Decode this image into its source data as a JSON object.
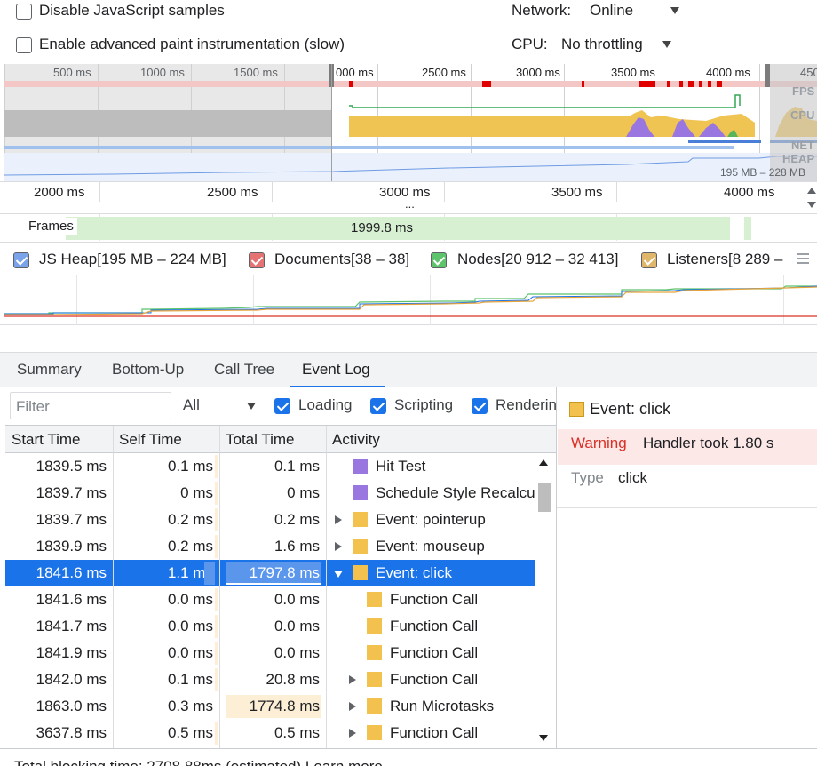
{
  "settings": {
    "disable_js_samples": "Disable JavaScript samples",
    "advanced_paint": "Enable advanced paint instrumentation (slow)",
    "network_label": "Network:",
    "network_value": "Online",
    "cpu_label": "CPU:",
    "cpu_value": "No throttling"
  },
  "overview": {
    "ticks": [
      "500 ms",
      "1000 ms",
      "1500 ms",
      "000 ms",
      "2500 ms",
      "3000 ms",
      "3500 ms",
      "4000 ms",
      "450"
    ],
    "tracks": [
      "FPS",
      "CPU",
      "NET",
      "HEAP"
    ],
    "heap_range": "195 MB – 228 MB"
  },
  "ruler": {
    "ticks": [
      "2000 ms",
      "2500 ms",
      "3000 ms",
      "3500 ms",
      "4000 ms"
    ],
    "ellipsis": "..."
  },
  "frames": {
    "label": "Frames",
    "value": "1999.8 ms"
  },
  "memory_legend": [
    {
      "label": "JS Heap[195 MB – 224 MB]",
      "color": "#8ab4f8"
    },
    {
      "label": "Documents[38 – 38]",
      "color": "#e57373"
    },
    {
      "label": "Nodes[20 912 – 32 413]",
      "color": "#81c995"
    },
    {
      "label": "Listeners[8 289 –",
      "color": "#e0b76a"
    }
  ],
  "tabs": [
    "Summary",
    "Bottom-Up",
    "Call Tree",
    "Event Log"
  ],
  "filter": {
    "placeholder": "Filter",
    "select_value": "All",
    "checks": [
      "Loading",
      "Scripting",
      "Renderin"
    ]
  },
  "columns": [
    "Start Time",
    "Self Time",
    "Total Time",
    "Activity"
  ],
  "rows": [
    {
      "start": "1839.5 ms",
      "self": "0.1 ms",
      "total": "0.1 ms",
      "activity": "Hit Test",
      "color": "#9a77e0",
      "expand": "none",
      "indent": 0
    },
    {
      "start": "1839.7 ms",
      "self": "0 ms",
      "total": "0 ms",
      "activity": "Schedule Style Recalcu",
      "color": "#9a77e0",
      "expand": "none",
      "indent": 0
    },
    {
      "start": "1839.7 ms",
      "self": "0.2 ms",
      "total": "0.2 ms",
      "activity": "Event: pointerup",
      "color": "#f2c14e",
      "expand": "right",
      "indent": 0
    },
    {
      "start": "1839.9 ms",
      "self": "0.2 ms",
      "total": "1.6 ms",
      "activity": "Event: mouseup",
      "color": "#f2c14e",
      "expand": "right",
      "indent": 0
    },
    {
      "start": "1841.6 ms",
      "self": "1.1 ms",
      "total": "1797.8 ms",
      "activity": "Event: click",
      "color": "#f2c14e",
      "expand": "down",
      "indent": 0,
      "selected": true
    },
    {
      "start": "1841.6 ms",
      "self": "0.0 ms",
      "total": "0.0 ms",
      "activity": "Function Call",
      "color": "#f2c14e",
      "expand": "none",
      "indent": 1
    },
    {
      "start": "1841.7 ms",
      "self": "0.0 ms",
      "total": "0.0 ms",
      "activity": "Function Call",
      "color": "#f2c14e",
      "expand": "none",
      "indent": 1
    },
    {
      "start": "1841.9 ms",
      "self": "0.0 ms",
      "total": "0.0 ms",
      "activity": "Function Call",
      "color": "#f2c14e",
      "expand": "none",
      "indent": 1
    },
    {
      "start": "1842.0 ms",
      "self": "0.1 ms",
      "total": "20.8 ms",
      "activity": "Function Call",
      "color": "#f2c14e",
      "expand": "right",
      "indent": 1
    },
    {
      "start": "1863.0 ms",
      "self": "0.3 ms",
      "total": "1774.8 ms",
      "activity": "Run Microtasks",
      "color": "#f2c14e",
      "expand": "right",
      "indent": 1
    },
    {
      "start": "3637.8 ms",
      "self": "0.5 ms",
      "total": "0.5 ms",
      "activity": "Function Call",
      "color": "#f2c14e",
      "expand": "right",
      "indent": 1
    }
  ],
  "details": {
    "title": "Event: click",
    "warning_label": "Warning",
    "warning_text": "Handler took 1.80 s",
    "type_label": "Type",
    "type_value": "click"
  },
  "footer": {
    "text": "Total blocking time: 2708.88ms (estimated) Learn more"
  }
}
